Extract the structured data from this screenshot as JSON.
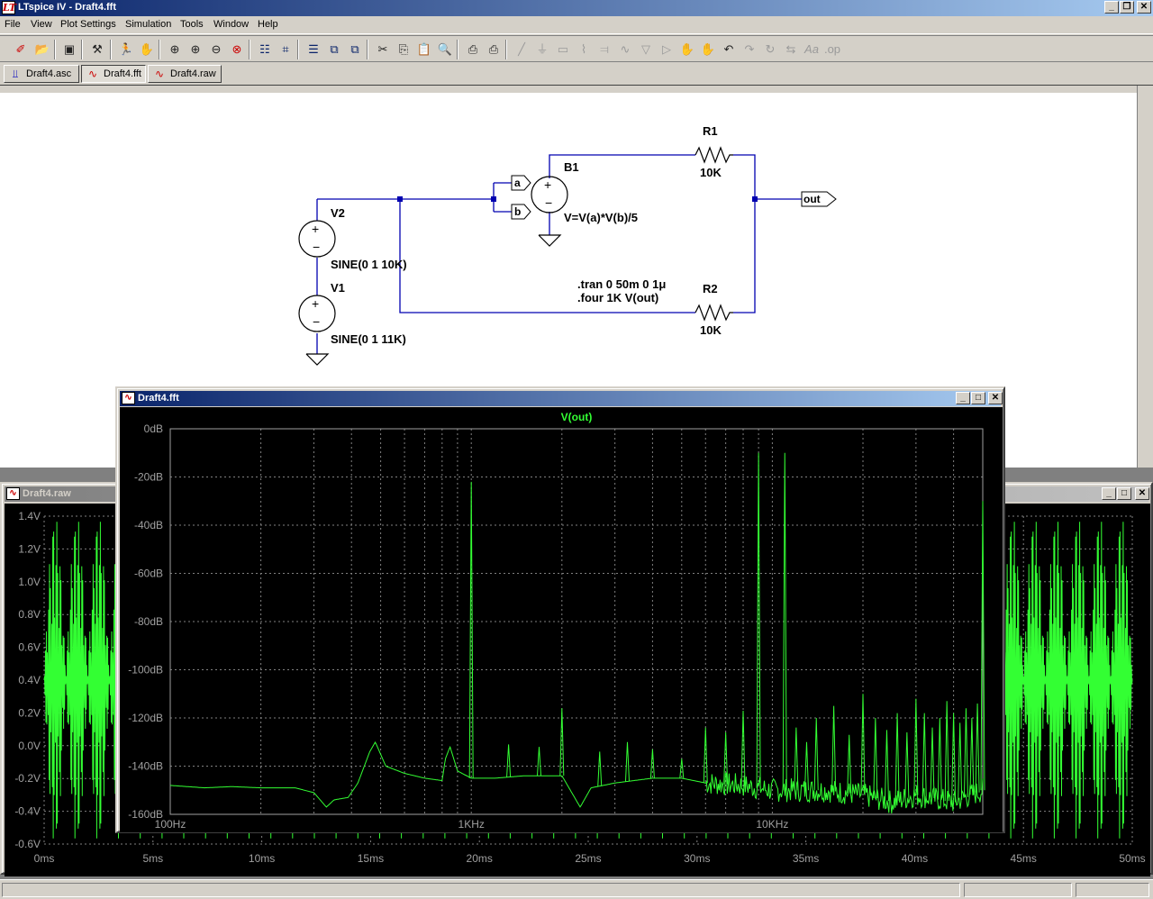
{
  "app": {
    "title": "LTspice IV - Draft4.fft",
    "icon_letter": "LT"
  },
  "menu": [
    "File",
    "View",
    "Plot Settings",
    "Simulation",
    "Tools",
    "Window",
    "Help"
  ],
  "tabs": [
    {
      "label": "Draft4.asc",
      "icon": "schematic-icon"
    },
    {
      "label": "Draft4.fft",
      "icon": "waveform-icon"
    },
    {
      "label": "Draft4.raw",
      "icon": "waveform-icon"
    }
  ],
  "schematic": {
    "components": {
      "v2_name": "V2",
      "v2_value": "SINE(0 1 10K)",
      "v1_name": "V1",
      "v1_value": "SINE(0 1 11K)",
      "b1_name": "B1",
      "b1_expr": "V=V(a)*V(b)/5",
      "r1_name": "R1",
      "r1_value": "10K",
      "r2_name": "R2",
      "r2_value": "10K",
      "label_a": "a",
      "label_b": "b",
      "label_out": "out"
    },
    "directives": {
      "tran": ".tran 0 50m 0 1μ",
      "four": ".four 1K V(out)"
    }
  },
  "fft_window": {
    "title": "Draft4.fft",
    "trace_name": "V(out)",
    "trace_color": "#33ff33"
  },
  "raw_window": {
    "title": "Draft4.raw"
  },
  "colors": {
    "plot_bg": "#000000",
    "trace": "#33ff33",
    "grid": "#808080",
    "wire": "#0000b0",
    "active_caption": "#0a246a"
  },
  "chart_data": [
    {
      "type": "line",
      "title": "V(out)",
      "x_scale": "log",
      "xlim": [
        100,
        50000
      ],
      "ylim": [
        -160,
        0
      ],
      "x_ticks": [
        {
          "v": 100,
          "label": "100Hz"
        },
        {
          "v": 1000,
          "label": "1KHz"
        },
        {
          "v": 10000,
          "label": "10KHz"
        }
      ],
      "y_ticks": [
        {
          "v": 0,
          "label": "0dB"
        },
        {
          "v": -20,
          "label": "-20dB"
        },
        {
          "v": -40,
          "label": "-40dB"
        },
        {
          "v": -60,
          "label": "-60dB"
        },
        {
          "v": -80,
          "label": "-80dB"
        },
        {
          "v": -100,
          "label": "-100dB"
        },
        {
          "v": -120,
          "label": "-120dB"
        },
        {
          "v": -140,
          "label": "-140dB"
        },
        {
          "v": -160,
          "label": "-160dB"
        }
      ],
      "grid": true,
      "series": [
        {
          "name": "V(out)",
          "floor": [
            [
              100,
              -148
            ],
            [
              130,
              -149
            ],
            [
              160,
              -148.5
            ],
            [
              200,
              -149
            ],
            [
              260,
              -149
            ],
            [
              300,
              -151
            ],
            [
              330,
              -157
            ],
            [
              350,
              -154
            ],
            [
              390,
              -153
            ],
            [
              420,
              -147
            ],
            [
              460,
              -134
            ],
            [
              480,
              -130
            ],
            [
              520,
              -140
            ],
            [
              600,
              -143
            ],
            [
              700,
              -145
            ],
            [
              800,
              -146
            ],
            [
              820,
              -137
            ],
            [
              850,
              -132
            ],
            [
              900,
              -142
            ],
            [
              1000,
              -145
            ],
            [
              1200,
              -145
            ],
            [
              1500,
              -144
            ],
            [
              2000,
              -144
            ],
            [
              2300,
              -157
            ],
            [
              2500,
              -149
            ],
            [
              3000,
              -147
            ],
            [
              4000,
              -145
            ],
            [
              5000,
              -145
            ],
            [
              6000,
              -147
            ],
            [
              8000,
              -148
            ],
            [
              10000,
              -150
            ],
            [
              15000,
              -150
            ],
            [
              20000,
              -152
            ],
            [
              25000,
              -155
            ],
            [
              30000,
              -152
            ],
            [
              40000,
              -155
            ],
            [
              50000,
              -150
            ]
          ],
          "peaks": [
            [
              1000,
              -22
            ],
            [
              11000,
              -10
            ],
            [
              9000,
              -10
            ],
            [
              2000,
              -116
            ],
            [
              1330,
              -131
            ],
            [
              1680,
              -132
            ],
            [
              2670,
              -134
            ],
            [
              3300,
              -130
            ],
            [
              4000,
              -133
            ],
            [
              5000,
              -137
            ],
            [
              6000,
              -124
            ],
            [
              7000,
              -126
            ],
            [
              8000,
              -117
            ],
            [
              12000,
              -124
            ],
            [
              13000,
              -130
            ],
            [
              14000,
              -120
            ],
            [
              16000,
              -115
            ],
            [
              18000,
              -127
            ],
            [
              20000,
              -110
            ],
            [
              22000,
              -120
            ],
            [
              24000,
              -125
            ],
            [
              26000,
              -118
            ],
            [
              28000,
              -126
            ],
            [
              30000,
              -112
            ],
            [
              32000,
              -118
            ],
            [
              34000,
              -124
            ],
            [
              36000,
              -120
            ],
            [
              38000,
              -113
            ],
            [
              40000,
              -118
            ],
            [
              42000,
              -122
            ],
            [
              44000,
              -116
            ],
            [
              46000,
              -120
            ],
            [
              48000,
              -114
            ],
            [
              50000,
              -30
            ]
          ]
        }
      ]
    },
    {
      "type": "line",
      "xlim": [
        0,
        50
      ],
      "ylim": [
        -0.6,
        1.4
      ],
      "x_ticks": [
        {
          "v": 0,
          "label": "0ms"
        },
        {
          "v": 5,
          "label": "5ms"
        },
        {
          "v": 10,
          "label": "10ms"
        },
        {
          "v": 15,
          "label": "15ms"
        },
        {
          "v": 20,
          "label": "20ms"
        },
        {
          "v": 25,
          "label": "25ms"
        },
        {
          "v": 30,
          "label": "30ms"
        },
        {
          "v": 35,
          "label": "35ms"
        },
        {
          "v": 40,
          "label": "40ms"
        },
        {
          "v": 45,
          "label": "45ms"
        },
        {
          "v": 50,
          "label": "50ms"
        }
      ],
      "y_ticks": [
        {
          "v": 1.4,
          "label": "1.4V"
        },
        {
          "v": 1.2,
          "label": "1.2V"
        },
        {
          "v": 1.0,
          "label": "1.0V"
        },
        {
          "v": 0.8,
          "label": "0.8V"
        },
        {
          "v": 0.6,
          "label": "0.6V"
        },
        {
          "v": 0.4,
          "label": "0.4V"
        },
        {
          "v": 0.2,
          "label": "0.2V"
        },
        {
          "v": 0.0,
          "label": "0.0V"
        },
        {
          "v": -0.2,
          "label": "-0.2V"
        },
        {
          "v": -0.4,
          "label": "-0.4V"
        },
        {
          "v": -0.6,
          "label": "-0.6V"
        }
      ],
      "grid": true,
      "series": [
        {
          "name": "V(out)",
          "beat_period_ms": 1.0,
          "carrier_cycles_per_ms": 21,
          "amp_max": 1.4,
          "amp_min": -0.6
        }
      ]
    }
  ]
}
